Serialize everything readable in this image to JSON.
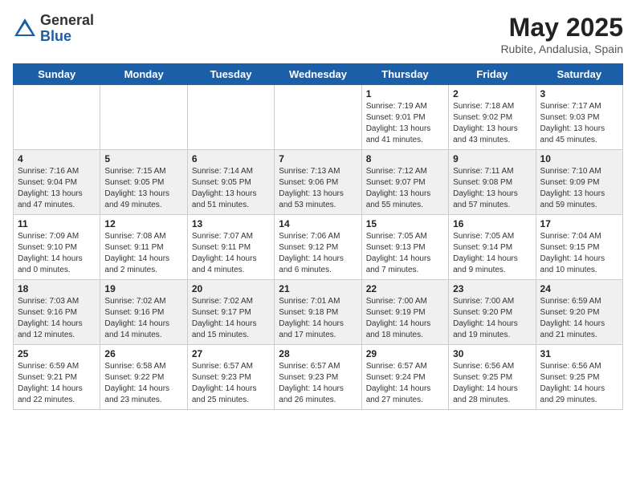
{
  "header": {
    "logo_general": "General",
    "logo_blue": "Blue",
    "month_year": "May 2025",
    "location": "Rubite, Andalusia, Spain"
  },
  "weekdays": [
    "Sunday",
    "Monday",
    "Tuesday",
    "Wednesday",
    "Thursday",
    "Friday",
    "Saturday"
  ],
  "weeks": [
    [
      {
        "day": "",
        "info": ""
      },
      {
        "day": "",
        "info": ""
      },
      {
        "day": "",
        "info": ""
      },
      {
        "day": "",
        "info": ""
      },
      {
        "day": "1",
        "info": "Sunrise: 7:19 AM\nSunset: 9:01 PM\nDaylight: 13 hours\nand 41 minutes."
      },
      {
        "day": "2",
        "info": "Sunrise: 7:18 AM\nSunset: 9:02 PM\nDaylight: 13 hours\nand 43 minutes."
      },
      {
        "day": "3",
        "info": "Sunrise: 7:17 AM\nSunset: 9:03 PM\nDaylight: 13 hours\nand 45 minutes."
      }
    ],
    [
      {
        "day": "4",
        "info": "Sunrise: 7:16 AM\nSunset: 9:04 PM\nDaylight: 13 hours\nand 47 minutes."
      },
      {
        "day": "5",
        "info": "Sunrise: 7:15 AM\nSunset: 9:05 PM\nDaylight: 13 hours\nand 49 minutes."
      },
      {
        "day": "6",
        "info": "Sunrise: 7:14 AM\nSunset: 9:05 PM\nDaylight: 13 hours\nand 51 minutes."
      },
      {
        "day": "7",
        "info": "Sunrise: 7:13 AM\nSunset: 9:06 PM\nDaylight: 13 hours\nand 53 minutes."
      },
      {
        "day": "8",
        "info": "Sunrise: 7:12 AM\nSunset: 9:07 PM\nDaylight: 13 hours\nand 55 minutes."
      },
      {
        "day": "9",
        "info": "Sunrise: 7:11 AM\nSunset: 9:08 PM\nDaylight: 13 hours\nand 57 minutes."
      },
      {
        "day": "10",
        "info": "Sunrise: 7:10 AM\nSunset: 9:09 PM\nDaylight: 13 hours\nand 59 minutes."
      }
    ],
    [
      {
        "day": "11",
        "info": "Sunrise: 7:09 AM\nSunset: 9:10 PM\nDaylight: 14 hours\nand 0 minutes."
      },
      {
        "day": "12",
        "info": "Sunrise: 7:08 AM\nSunset: 9:11 PM\nDaylight: 14 hours\nand 2 minutes."
      },
      {
        "day": "13",
        "info": "Sunrise: 7:07 AM\nSunset: 9:11 PM\nDaylight: 14 hours\nand 4 minutes."
      },
      {
        "day": "14",
        "info": "Sunrise: 7:06 AM\nSunset: 9:12 PM\nDaylight: 14 hours\nand 6 minutes."
      },
      {
        "day": "15",
        "info": "Sunrise: 7:05 AM\nSunset: 9:13 PM\nDaylight: 14 hours\nand 7 minutes."
      },
      {
        "day": "16",
        "info": "Sunrise: 7:05 AM\nSunset: 9:14 PM\nDaylight: 14 hours\nand 9 minutes."
      },
      {
        "day": "17",
        "info": "Sunrise: 7:04 AM\nSunset: 9:15 PM\nDaylight: 14 hours\nand 10 minutes."
      }
    ],
    [
      {
        "day": "18",
        "info": "Sunrise: 7:03 AM\nSunset: 9:16 PM\nDaylight: 14 hours\nand 12 minutes."
      },
      {
        "day": "19",
        "info": "Sunrise: 7:02 AM\nSunset: 9:16 PM\nDaylight: 14 hours\nand 14 minutes."
      },
      {
        "day": "20",
        "info": "Sunrise: 7:02 AM\nSunset: 9:17 PM\nDaylight: 14 hours\nand 15 minutes."
      },
      {
        "day": "21",
        "info": "Sunrise: 7:01 AM\nSunset: 9:18 PM\nDaylight: 14 hours\nand 17 minutes."
      },
      {
        "day": "22",
        "info": "Sunrise: 7:00 AM\nSunset: 9:19 PM\nDaylight: 14 hours\nand 18 minutes."
      },
      {
        "day": "23",
        "info": "Sunrise: 7:00 AM\nSunset: 9:20 PM\nDaylight: 14 hours\nand 19 minutes."
      },
      {
        "day": "24",
        "info": "Sunrise: 6:59 AM\nSunset: 9:20 PM\nDaylight: 14 hours\nand 21 minutes."
      }
    ],
    [
      {
        "day": "25",
        "info": "Sunrise: 6:59 AM\nSunset: 9:21 PM\nDaylight: 14 hours\nand 22 minutes."
      },
      {
        "day": "26",
        "info": "Sunrise: 6:58 AM\nSunset: 9:22 PM\nDaylight: 14 hours\nand 23 minutes."
      },
      {
        "day": "27",
        "info": "Sunrise: 6:57 AM\nSunset: 9:23 PM\nDaylight: 14 hours\nand 25 minutes."
      },
      {
        "day": "28",
        "info": "Sunrise: 6:57 AM\nSunset: 9:23 PM\nDaylight: 14 hours\nand 26 minutes."
      },
      {
        "day": "29",
        "info": "Sunrise: 6:57 AM\nSunset: 9:24 PM\nDaylight: 14 hours\nand 27 minutes."
      },
      {
        "day": "30",
        "info": "Sunrise: 6:56 AM\nSunset: 9:25 PM\nDaylight: 14 hours\nand 28 minutes."
      },
      {
        "day": "31",
        "info": "Sunrise: 6:56 AM\nSunset: 9:25 PM\nDaylight: 14 hours\nand 29 minutes."
      }
    ]
  ]
}
